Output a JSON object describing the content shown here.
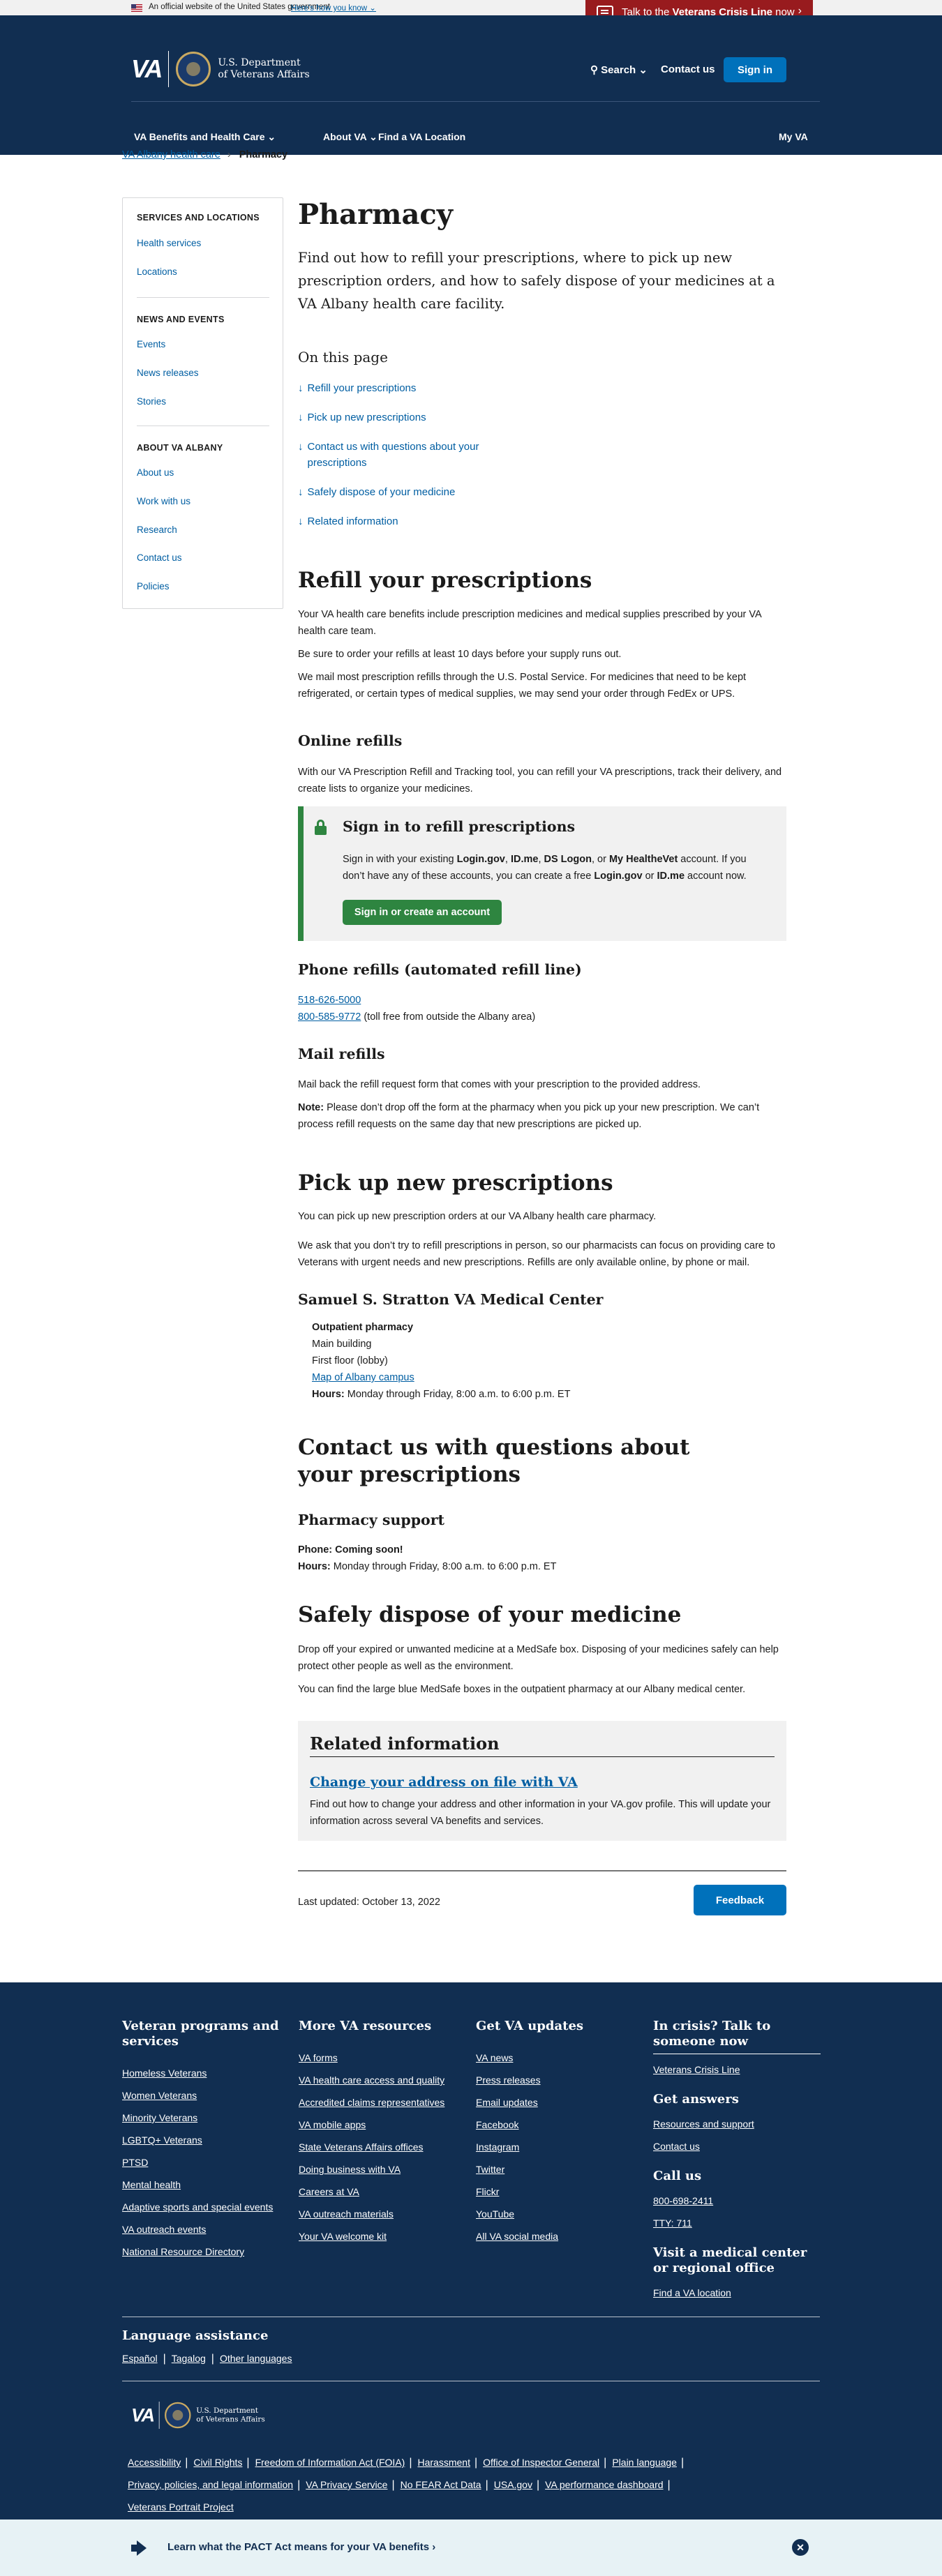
{
  "banner": {
    "text": "An official website of the United States government",
    "link": "Here’s how you know ⌄"
  },
  "crisis": {
    "prefix": "Talk to the ",
    "strong": "Veterans Crisis Line",
    "suffix": " now",
    "arrow": "›"
  },
  "header": {
    "logo_text": "VA",
    "dept_line1": "U.S. Department",
    "dept_line2": "of Veterans Affairs",
    "search": "Search",
    "contact": "Contact us",
    "signin": "Sign in"
  },
  "nav": {
    "item1": "VA Benefits and Health Care ⌄",
    "item2": "About VA ⌄",
    "item3": "Find a VA Location",
    "item4": "My VA"
  },
  "breadcrumb": {
    "link": "VA Albany health care",
    "sep": "›",
    "current": "Pharmacy"
  },
  "sidebar": {
    "h1": "Services and locations",
    "l1": "Health services",
    "l2": "Locations",
    "h2": "News and events",
    "l3": "Events",
    "l4": "News releases",
    "l5": "Stories",
    "h3": "About VA Albany",
    "l6": "About us",
    "l7": "Work with us",
    "l8": "Research",
    "l9": "Contact us",
    "l10": "Policies"
  },
  "page": {
    "title": "Pharmacy",
    "lead": "Find out how to refill your prescriptions, where to pick up new prescription orders, and how to safely dispose of your medicines at a VA Albany health care facility."
  },
  "toc": {
    "heading": "On this page",
    "arrow": "↓",
    "t1": "Refill your prescriptions",
    "t2": "Pick up new prescriptions",
    "t3": "Contact us with questions about your prescriptions",
    "t4": "Safely dispose of your medicine",
    "t5": "Related information"
  },
  "refill": {
    "heading": "Refill your prescriptions",
    "p1": "Your VA health care benefits include prescription medicines and medical supplies prescribed by your VA health care team.",
    "p2": "Be sure to order your refills at least 10 days before your supply runs out.",
    "p3": "We mail most prescription refills through the U.S. Postal Service. For medicines that need to be kept refrigerated, or certain types of medical supplies, we may send your order through FedEx or UPS.",
    "online_heading": "Online refills",
    "online_p": "With our VA Prescription Refill and Tracking tool, you can refill your VA prescriptions, track their delivery, and create lists to organize your medicines."
  },
  "signin_box": {
    "title": "Sign in to refill prescriptions",
    "a": "Sign in with your existing ",
    "b1": "Login.gov",
    "c": ", ",
    "b2": "ID.me",
    "d": ", ",
    "b3": "DS Logon",
    "e": ", or ",
    "b4": "My HealtheVet",
    "f": " account. If you don’t have any of these accounts, you can create a free ",
    "b5": "Login.gov",
    "g": " or ",
    "b6": "ID.me",
    "h": " account now.",
    "button": "Sign in or create an account"
  },
  "phone": {
    "heading": "Phone refills (automated refill line)",
    "n1": "518-626-5000",
    "n2": "800-585-9772",
    "n2_note": " (toll free from outside the Albany area)"
  },
  "mail": {
    "heading": "Mail refills",
    "p1": "Mail back the refill request form that comes with your prescription to the provided address.",
    "note_label": "Note:",
    "note": " Please don’t drop off the form at the pharmacy when you pick up your new prescription. We can’t process refill requests on the same day that new prescriptions are picked up."
  },
  "pickup": {
    "heading": "Pick up new prescriptions",
    "p1": "You can pick up new prescription orders at our VA Albany health care pharmacy.",
    "p2": "We ask that you don’t try to refill prescriptions in person, so our pharmacists can focus on providing care to Veterans with urgent needs and new prescriptions. Refills are only available online, by phone or mail.",
    "facility": "Samuel S. Stratton VA Medical Center",
    "a1": "Outpatient pharmacy",
    "a2": "Main building",
    "a3": "First floor (lobby)",
    "a4": "Map of Albany campus",
    "hours_label": "Hours:",
    "hours": " Monday through Friday, 8:00 a.m. to 6:00 p.m. ET"
  },
  "contact": {
    "heading": "Contact us with questions about your prescriptions",
    "sub": "Pharmacy support",
    "phone_label": "Phone:",
    "phone": " Coming soon!",
    "hours_label": "Hours:",
    "hours": " Monday through Friday, 8:00 a.m. to 6:00 p.m. ET"
  },
  "dispose": {
    "heading": "Safely dispose of your medicine",
    "p1": "Drop off your expired or unwanted medicine at a MedSafe box. Disposing of your medicines safely can help protect other people as well as the environment.",
    "p2": "You can find the large blue MedSafe boxes in the outpatient pharmacy at our Albany medical center."
  },
  "related": {
    "heading": "Related information",
    "link": "Change your address on file with VA",
    "desc": "Find out how to change your address and other information in your VA.gov profile. This will update your information across several VA benefits and services."
  },
  "meta": {
    "updated": "Last updated: October 13, 2022",
    "feedback": "Feedback"
  },
  "footer": {
    "c1_title": "Veteran programs and services",
    "c1": [
      "Homeless Veterans",
      "Women Veterans",
      "Minority Veterans",
      "LGBTQ+ Veterans",
      "PTSD",
      "Mental health",
      "Adaptive sports and special events",
      "VA outreach events",
      "National Resource Directory"
    ],
    "c2_title": "More VA resources",
    "c2": [
      "VA forms",
      "VA health care access and quality",
      "Accredited claims representatives",
      "VA mobile apps",
      "State Veterans Affairs offices",
      "Doing business with VA",
      "Careers at VA",
      "VA outreach materials",
      "Your VA welcome kit"
    ],
    "c3_title": "Get VA updates",
    "c3": [
      "VA news",
      "Press releases",
      "Email updates",
      "Facebook",
      "Instagram",
      "Twitter",
      "Flickr",
      "YouTube",
      "All VA social media"
    ],
    "c4_title": "In crisis? Talk to someone now",
    "c4_link": "Veterans Crisis Line",
    "c4_answers": "Get answers",
    "c4_a1": "Resources and support",
    "c4_a2": "Contact us",
    "c4_call": "Call us",
    "c4_phone": "800-698-2411",
    "c4_tty": "TTY: 711",
    "c4_visit": "Visit a medical center or regional office",
    "c4_find": "Find a VA location",
    "lang_title": "Language assistance",
    "lang1": "Español",
    "lang2": "Tagalog",
    "lang3": "Other languages",
    "pipe": "|",
    "logo_text": "VA",
    "dept_line1": "U.S. Department",
    "dept_line2": "of Veterans Affairs",
    "legal": [
      "Accessibility",
      "Civil Rights",
      "Freedom of Information Act (FOIA)",
      "Harassment",
      "Office of Inspector General",
      "Plain language",
      "Privacy, policies, and legal information",
      "VA Privacy Service",
      "No FEAR Act Data",
      "USA.gov",
      "VA performance dashboard",
      "Veterans Portrait Project"
    ]
  },
  "pact": {
    "text": "Learn what the PACT Act means for your VA benefits ›",
    "close": "✕"
  },
  "colors": {
    "navy": "#112e51",
    "link": "#005ea2",
    "button": "#0071bb",
    "green": "#2e8540",
    "crisis": "#981b1e"
  }
}
